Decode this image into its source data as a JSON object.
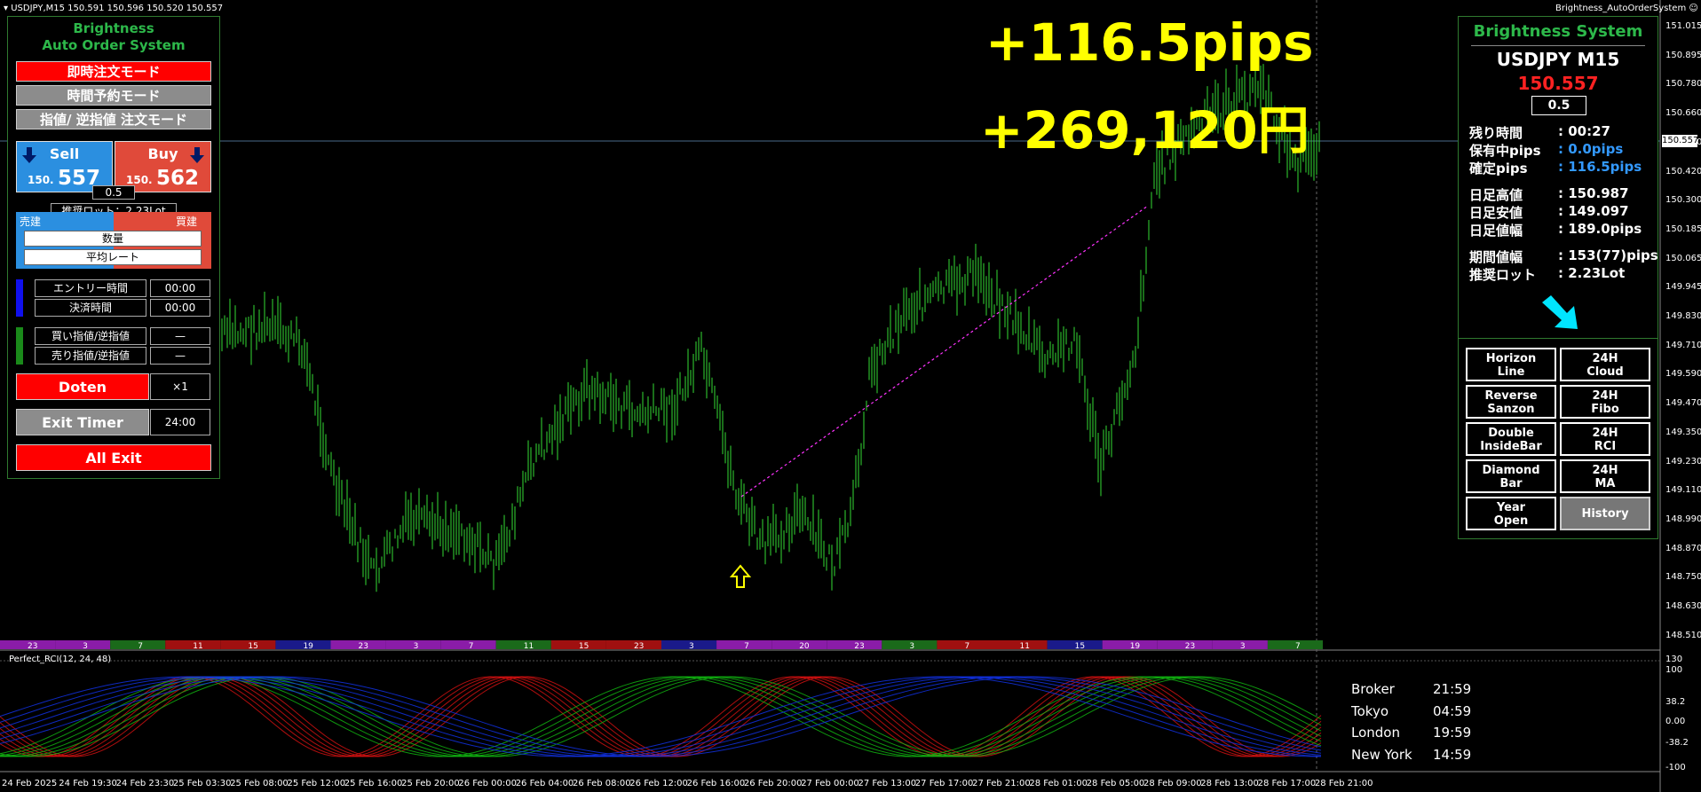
{
  "window": {
    "symbol_info": "USDJPY,M15  150.591 150.596 150.520 150.557",
    "ea_name": "Brightness_AutoOrderSystem"
  },
  "overlay": {
    "pips": "+116.5pips",
    "yen": "+269,120円"
  },
  "left_panel": {
    "title1": "Brightness",
    "title2": "Auto Order System",
    "mode_instant": "即時注文モード",
    "mode_time": "時間予約モード",
    "mode_limit": "指値/ 逆指値 注文モード",
    "sell": {
      "label": "Sell",
      "prefix": "150.",
      "price": "557"
    },
    "buy": {
      "label": "Buy",
      "prefix": "150.",
      "price": "562"
    },
    "lot_value": "0.5",
    "recommended_lot": "推奨ロット：2.23Lot",
    "sell_side": "売建",
    "buy_side": "買建",
    "quantity": "数量",
    "avg_rate": "平均レート",
    "entry_time_label": "エントリー時間",
    "entry_time": "00:00",
    "exit_time_label": "決済時間",
    "exit_time": "00:00",
    "buy_limit_label": "買い指値/逆指値",
    "buy_limit": "—",
    "sell_limit_label": "売り指値/逆指値",
    "sell_limit": "—",
    "doten": "Doten",
    "doten_mult": "×1",
    "exit_timer": "Exit Timer",
    "exit_timer_value": "24:00",
    "all_exit": "All Exit"
  },
  "right_panel": {
    "title": "Brightness System",
    "pair": "USDJPY  M15",
    "price": "150.557",
    "lot": "0.5",
    "rows": [
      {
        "label": "残り時間",
        "value": ": 00:27"
      },
      {
        "label": "保有中pips",
        "value": ": 0.0pips"
      },
      {
        "label": "確定pips",
        "value": ": 116.5pips"
      },
      {
        "label": "日足高値",
        "value": ": 150.987"
      },
      {
        "label": "日足安値",
        "value": ": 149.097"
      },
      {
        "label": "日足値幅",
        "value": ": 189.0pips"
      },
      {
        "label": "期間値幅",
        "value": ": 153(77)pips"
      },
      {
        "label": "推奨ロット",
        "value": ": 2.23Lot"
      }
    ],
    "buttons": [
      {
        "l1": "Horizon",
        "l2": "Line"
      },
      {
        "l1": "24H",
        "l2": "Cloud"
      },
      {
        "l1": "Reverse",
        "l2": "Sanzon"
      },
      {
        "l1": "24H",
        "l2": "Fibo"
      },
      {
        "l1": "Double",
        "l2": "InsideBar"
      },
      {
        "l1": "24H",
        "l2": "RCI"
      },
      {
        "l1": "Diamond",
        "l2": "Bar"
      },
      {
        "l1": "24H",
        "l2": "MA"
      },
      {
        "l1": "Year",
        "l2": "Open"
      },
      {
        "l1": "History",
        "l2": ""
      }
    ]
  },
  "price_axis": [
    "151.015",
    "150.895",
    "150.780",
    "150.660",
    "150.540",
    "150.420",
    "150.300",
    "150.185",
    "150.065",
    "149.945",
    "149.830",
    "149.710",
    "149.590",
    "149.470",
    "149.350",
    "149.230",
    "149.110",
    "148.990",
    "148.870",
    "148.750",
    "148.630",
    "148.510"
  ],
  "current_price_tag": "150.557",
  "session_bar": [
    "23",
    "3",
    "7",
    "11",
    "15",
    "19",
    "23",
    "3",
    "7",
    "11",
    "15",
    "23",
    "3",
    "7",
    "20",
    "23",
    "3",
    "7",
    "11",
    "15",
    "19",
    "23",
    "3",
    "7"
  ],
  "indicator": {
    "name": "Perfect_RCI(12, 24, 48)",
    "axis": [
      "130",
      "100",
      "38.2",
      "0.00",
      "-38.2",
      "-100"
    ]
  },
  "clock": [
    {
      "label": "Broker",
      "time": "21:59"
    },
    {
      "label": "Tokyo",
      "time": "04:59"
    },
    {
      "label": "London",
      "time": "19:59"
    },
    {
      "label": "New York",
      "time": "14:59"
    }
  ],
  "time_axis": [
    "24 Feb 2025",
    "24 Feb 19:30",
    "24 Feb 23:30",
    "25 Feb 03:30",
    "25 Feb 08:00",
    "25 Feb 12:00",
    "25 Feb 16:00",
    "25 Feb 20:00",
    "26 Feb 00:00",
    "26 Feb 04:00",
    "26 Feb 08:00",
    "26 Feb 12:00",
    "26 Feb 16:00",
    "26 Feb 20:00",
    "27 Feb 00:00",
    "27 Feb 13:00",
    "27 Feb 17:00",
    "27 Feb 21:00",
    "28 Feb 01:00",
    "28 Feb 05:00",
    "28 Feb 09:00",
    "28 Feb 13:00",
    "28 Feb 17:00",
    "28 Feb 21:00"
  ],
  "colors": {
    "candle": "#33dd33",
    "panel_border": "#2f7a2f",
    "price_red": "#ff2222",
    "accent_blue": "#3399ff",
    "overlay_yellow": "#ffff00"
  }
}
